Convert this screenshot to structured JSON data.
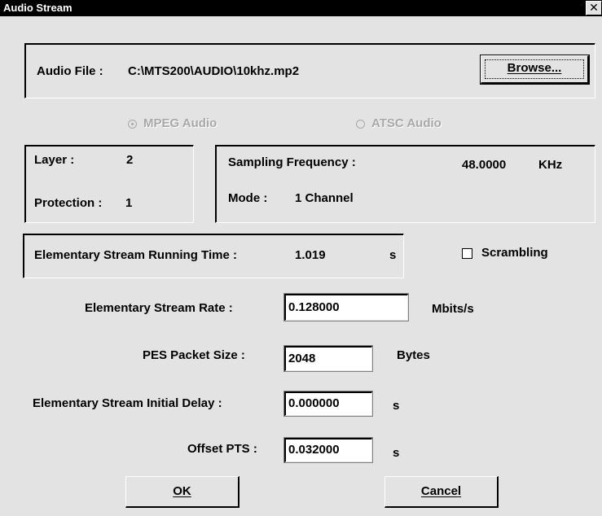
{
  "window": {
    "title": "Audio Stream",
    "close_glyph": "✕"
  },
  "file": {
    "label": "Audio File :",
    "path": "C:\\MTS200\\AUDIO\\10khz.mp2",
    "browse_label": "Browse..."
  },
  "format": {
    "mpeg_label": "MPEG Audio",
    "atsc_label": "ATSC Audio",
    "selected": "MPEG Audio"
  },
  "layer": {
    "layer_label": "Layer :",
    "layer_value": "2",
    "protection_label": "Protection :",
    "protection_value": "1"
  },
  "sampling": {
    "label": "Sampling Frequency :",
    "value": "48.0000",
    "unit": "KHz",
    "mode_label": "Mode :",
    "mode_value": "1 Channel"
  },
  "running_time": {
    "label": "Elementary Stream Running Time :",
    "value": "1.019",
    "unit": "s"
  },
  "scrambling": {
    "label": "Scrambling",
    "checked": false
  },
  "fields": {
    "rate_label": "Elementary Stream Rate :",
    "rate_value": "0.128000",
    "rate_unit": "Mbits/s",
    "pes_label": "PES Packet Size :",
    "pes_value": "2048",
    "pes_unit": "Bytes",
    "delay_label": "Elementary Stream Initial Delay :",
    "delay_value": "0.000000",
    "delay_unit": "s",
    "pts_label": "Offset PTS :",
    "pts_value": "0.032000",
    "pts_unit": "s"
  },
  "buttons": {
    "ok_label": "OK",
    "cancel_label": "Cancel"
  }
}
